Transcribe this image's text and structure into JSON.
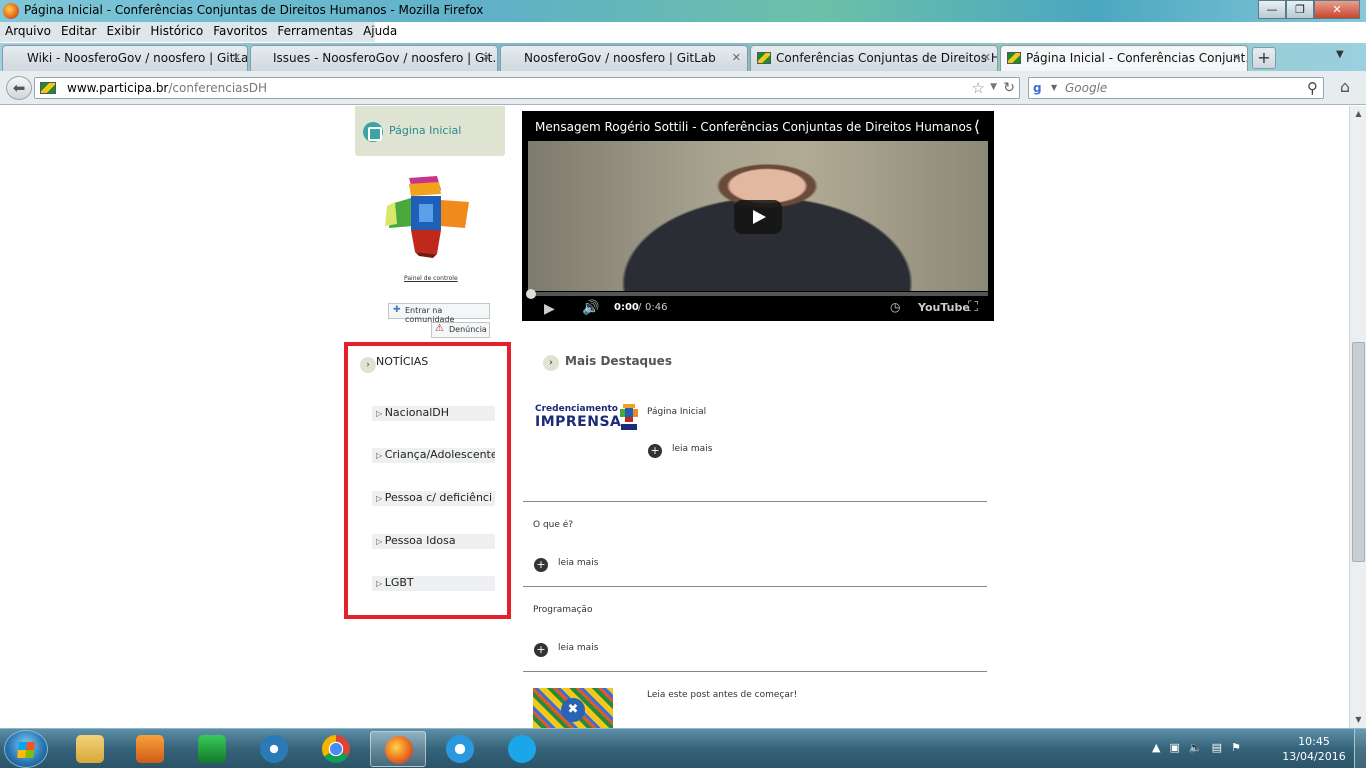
{
  "window": {
    "title": "Página Inicial - Conferências Conjuntas de Direitos Humanos - Mozilla Firefox",
    "controls": {
      "minimize": "—",
      "maximize": "❐",
      "close": "✕"
    }
  },
  "menu": [
    "Arquivo",
    "Editar",
    "Exibir",
    "Histórico",
    "Favoritos",
    "Ferramentas",
    "Ajuda"
  ],
  "tabs": [
    {
      "label": "Wiki - NoosferoGov / noosfero | GitLab",
      "active": false
    },
    {
      "label": "Issues - NoosferoGov / noosfero | Git...",
      "active": false
    },
    {
      "label": "NoosferoGov / noosfero | GitLab",
      "active": false
    },
    {
      "label": "Conferências Conjuntas de Direitos H...",
      "active": false
    },
    {
      "label": "Página Inicial - Conferências Conjunt...",
      "active": true
    }
  ],
  "nav": {
    "url_domain": "www.participa.br",
    "url_path": "/conferenciasDH",
    "search_placeholder": "Google"
  },
  "sidebar": {
    "home_label": "Página Inicial",
    "control_panel": "Painel de controle",
    "join_label": "Entrar na comunidade",
    "report_label": "Denúncia",
    "news_title": "NOTÍCIAS",
    "news_items": [
      "NacionalDH",
      "Criança/Adolescente",
      "Pessoa c/ deficiênci",
      "Pessoa Idosa",
      "LGBT"
    ]
  },
  "video": {
    "title": "Mensagem Rogério Sottili - Conferências Conjuntas de Direitos Humanos",
    "current_time": "0:00",
    "duration": "0:46",
    "brand": "YouTube"
  },
  "main": {
    "highlights_title": "Mais Destaques",
    "press_line1": "Credenciamento",
    "press_line2": "IMPRENSA",
    "items": [
      {
        "title": "Página Inicial",
        "read_more": "leia mais"
      },
      {
        "title": "O que é?",
        "read_more": "leia mais"
      },
      {
        "title": "Programação",
        "read_more": "leia mais"
      },
      {
        "title": "Leia este post antes de começar!"
      }
    ]
  },
  "taskbar": {
    "time": "10:45",
    "date": "13/04/2016"
  }
}
